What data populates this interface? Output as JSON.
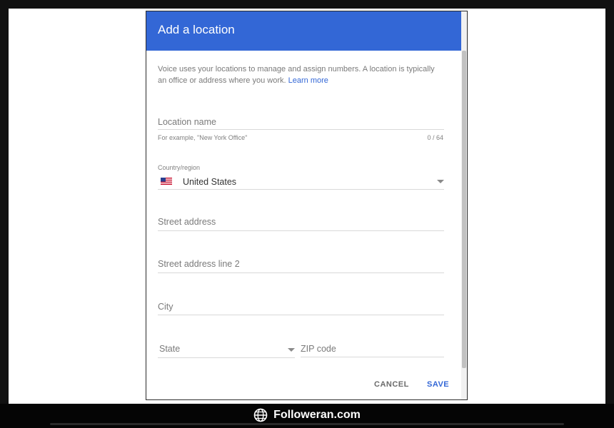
{
  "dialog": {
    "title": "Add a location",
    "intro_text": "Voice uses your locations to manage and assign numbers. A location is typically an office or address where you work.",
    "learn_more": "Learn more"
  },
  "form": {
    "location_name": {
      "placeholder": "Location name",
      "helper": "For example, \"New York Office\"",
      "counter": "0 / 64"
    },
    "country": {
      "label": "Country/region",
      "value": "United States",
      "flag_icon": "us-flag-icon"
    },
    "street_address": {
      "placeholder": "Street address"
    },
    "street_address_2": {
      "placeholder": "Street address line 2"
    },
    "city": {
      "placeholder": "City"
    },
    "state": {
      "placeholder": "State"
    },
    "zip": {
      "placeholder": "ZIP code"
    }
  },
  "actions": {
    "cancel": "CANCEL",
    "save": "SAVE"
  },
  "watermark": {
    "text": "Followeran.com",
    "icon": "globe-icon"
  },
  "colors": {
    "header": "#3367d6",
    "link": "#3367d6",
    "save": "#3367d6",
    "cancel": "#6b6b6b"
  }
}
